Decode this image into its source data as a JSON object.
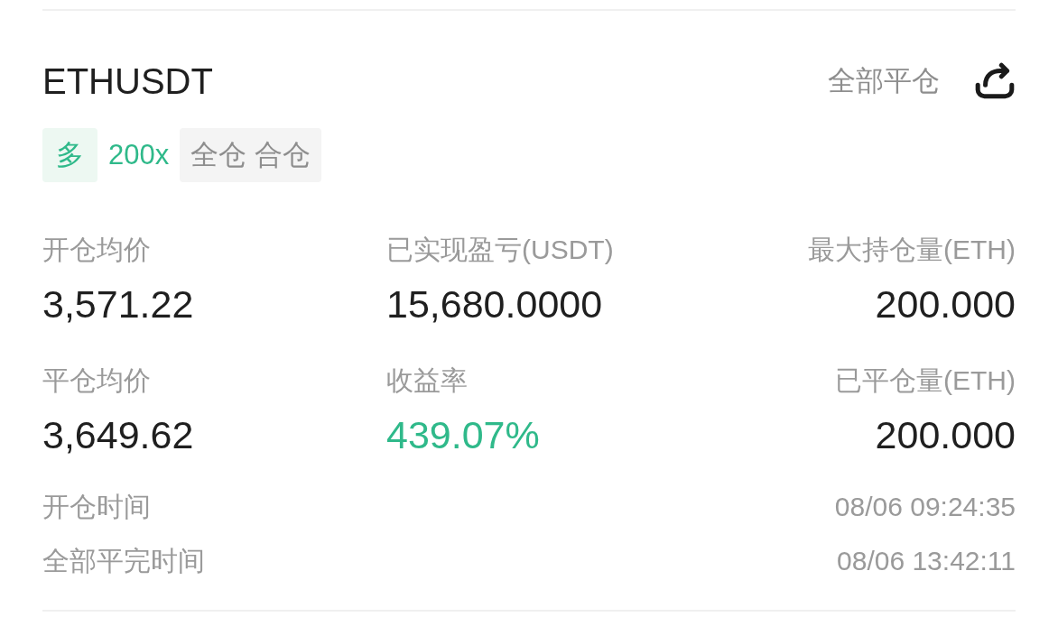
{
  "position": {
    "symbol": "ETHUSDT",
    "status": "全部平仓",
    "tags": [
      {
        "label": "多",
        "kind": "side"
      },
      {
        "label": "200x",
        "kind": "leverage"
      },
      {
        "label": "全仓 合仓",
        "kind": "mode"
      }
    ],
    "stats": [
      {
        "label": "开仓均价",
        "value": "3,571.22",
        "kind": "number"
      },
      {
        "label": "已实现盈亏(USDT)",
        "value": "15,680.0000",
        "kind": "number"
      },
      {
        "label": "最大持仓量(ETH)",
        "value": "200.000",
        "kind": "number"
      },
      {
        "label": "平仓均价",
        "value": "3,649.62",
        "kind": "number"
      },
      {
        "label": "收益率",
        "value": "439.07%",
        "kind": "profit"
      },
      {
        "label": "已平仓量(ETH)",
        "value": "200.000",
        "kind": "number"
      }
    ],
    "times": [
      {
        "label": "开仓时间",
        "value": "08/06 09:24:35"
      },
      {
        "label": "全部平完时间",
        "value": "08/06 13:42:11"
      }
    ]
  }
}
